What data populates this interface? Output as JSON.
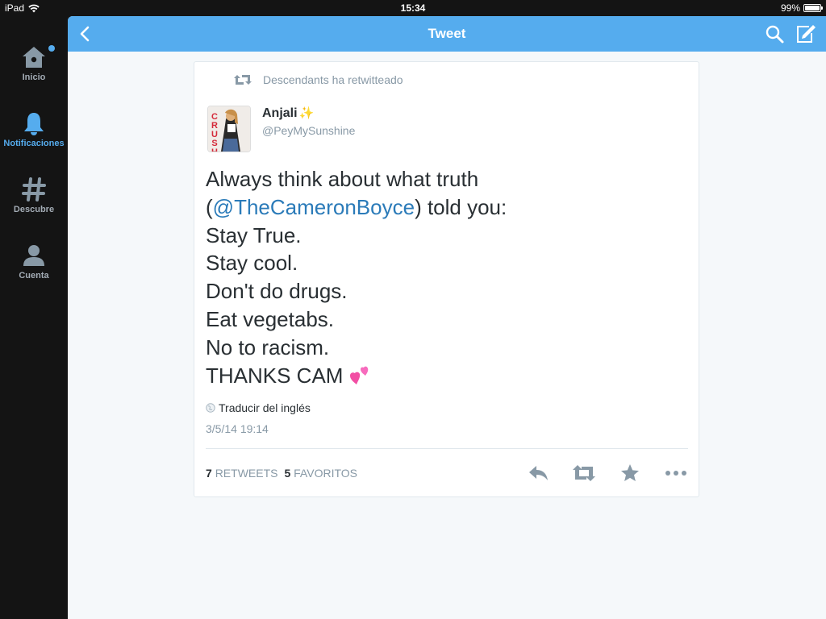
{
  "status_bar": {
    "device": "iPad",
    "time": "15:34",
    "battery": "99%",
    "battery_level": 0.99
  },
  "sidebar": {
    "items": [
      {
        "label": "Inicio",
        "icon": "home-icon",
        "active": false,
        "has_dot": true
      },
      {
        "label": "Notificaciones",
        "icon": "bell-icon",
        "active": true
      },
      {
        "label": "Descubre",
        "icon": "hashtag-icon",
        "active": false
      },
      {
        "label": "Cuenta",
        "icon": "person-icon",
        "active": false
      }
    ]
  },
  "header": {
    "title": "Tweet"
  },
  "tweet": {
    "retweeted_by": "Descendants ha retwitteado",
    "user_name": "Anjali",
    "user_name_emoji": "✨",
    "user_handle": "@PeyMySunshine",
    "text": {
      "line1": "Always think about what truth",
      "line2_open": "(",
      "mention": "@TheCameronBoyce",
      "line2_close": ") told you:",
      "line3": "Stay True.",
      "line4": "Stay cool.",
      "line5": "Don't do drugs.",
      "line6": "Eat vegetabs.",
      "line7": "No to racism.",
      "line8": "THANKS CAM"
    },
    "translate_label": "Traducir del inglés",
    "timestamp": "3/5/14 19:14",
    "retweets_count": "7",
    "retweets_label": "RETWEETS",
    "favorites_count": "5",
    "favorites_label": "FAVORITOS",
    "avatar_text": "CRUSH"
  },
  "colors": {
    "accent": "#55acee",
    "link": "#2b7bb9",
    "muted": "#8899a6",
    "text": "#292f33",
    "sidebar_bg": "#141414",
    "icon_gray": "#8899a6"
  }
}
